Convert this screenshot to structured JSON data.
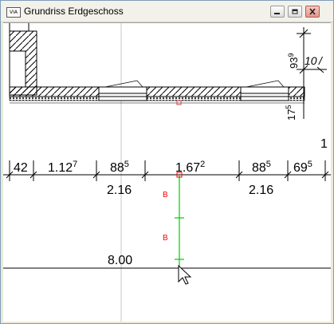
{
  "window": {
    "title": "Grundriss Erdgeschoss",
    "icon_label": "VIA",
    "buttons": {
      "minimize_icon": "minimize-icon",
      "maximize_icon": "maximize-icon",
      "close_icon": "close-icon"
    }
  },
  "colors": {
    "title_bg": "#f2f1ea",
    "close_button": "#d84a3a",
    "snap_marker": "#ff0000",
    "guide_line": "#00cc00",
    "axis_line": "#c8c8c8"
  },
  "drawing": {
    "right_dim_vertical": "93",
    "right_dim_vertical_sup": "9",
    "right_dim_small": "10",
    "right_dim_slash": "/",
    "right_dim_lower": "17",
    "right_dim_lower_sup": "5",
    "top_right_digit": "1",
    "dimension_chain": [
      {
        "main": "42",
        "sup": ""
      },
      {
        "main": "1.12",
        "sup": "7"
      },
      {
        "main": "88",
        "sup": "5"
      },
      {
        "main": "1.67",
        "sup": "2"
      },
      {
        "main": "88",
        "sup": "5"
      },
      {
        "main": "69",
        "sup": "5"
      }
    ],
    "sub_dimensions": [
      "2.16",
      "2.16"
    ],
    "markers": [
      "B",
      "B"
    ],
    "bottom_dimension": "8.00"
  }
}
